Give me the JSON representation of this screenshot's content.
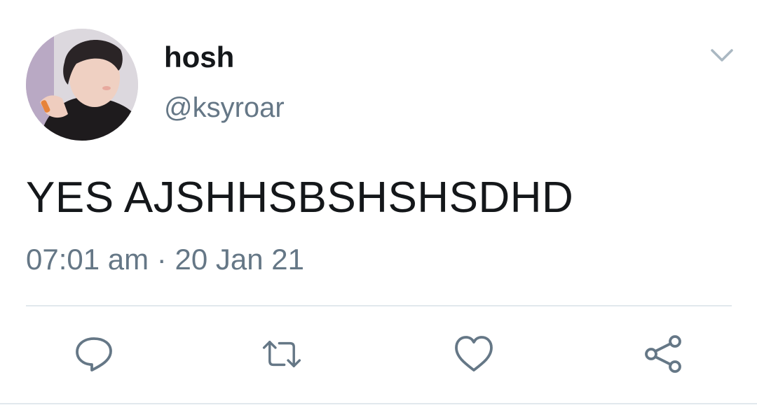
{
  "tweet": {
    "display_name": "hosh",
    "handle": "@ksyroar",
    "text": "YES AJSHHSBSHSHSDHD",
    "time": "07:01 am",
    "separator": "·",
    "date": "20 Jan 21"
  },
  "icons": {
    "menu": "chevron-down-icon",
    "reply": "reply-icon",
    "retweet": "retweet-icon",
    "like": "heart-icon",
    "share": "share-icon"
  },
  "colors": {
    "text_primary": "#14171a",
    "text_secondary": "#657786",
    "divider": "#e1e8ed"
  }
}
